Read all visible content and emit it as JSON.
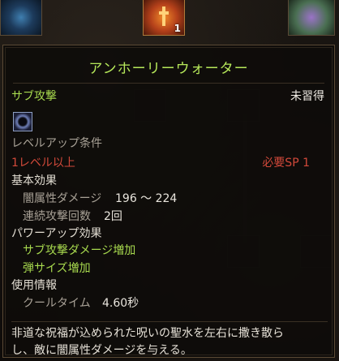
{
  "skill": {
    "name": "アンホーリーウォーター",
    "category": "サブ攻撃",
    "status": "未習得",
    "icon": "dark-orb-icon"
  },
  "levelup": {
    "heading": "レベルアップ条件",
    "requirement_level": "1レベル以上",
    "requirement_sp": "必要SP 1"
  },
  "basic": {
    "heading": "基本効果",
    "damage_label": "闇属性ダメージ",
    "damage_value": "196 ～ 224",
    "hits_label": "連続攻撃回数",
    "hits_value": "2回"
  },
  "powerup": {
    "heading": "パワーアップ効果",
    "effect1": "サブ攻撃ダメージ増加",
    "effect2": "弾サイズ増加"
  },
  "usage": {
    "heading": "使用情報",
    "cooldown_label": "クールタイム",
    "cooldown_value": "4.60秒"
  },
  "description_line1": "非道な祝福が込められた呪いの聖水を左右に撒き散ら",
  "description_line2": "し、敵に闇属性ダメージを与える。",
  "slots": {
    "mid_count": "1"
  },
  "colors": {
    "title": "#b6e85a",
    "green": "#a7d94e",
    "red": "#d2493a"
  }
}
